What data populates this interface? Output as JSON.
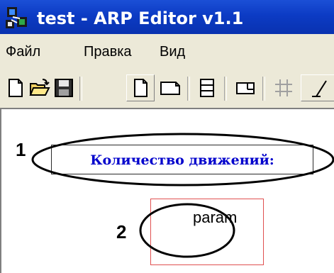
{
  "window": {
    "title": "test - ARP Editor v1.1",
    "app_icon": "arp-editor-app-icon"
  },
  "menubar": {
    "items": [
      {
        "label": "Файл"
      },
      {
        "label": "Правка"
      },
      {
        "label": "Вид"
      }
    ]
  },
  "toolbar": {
    "buttons": [
      {
        "icon": "new-document-icon"
      },
      {
        "icon": "open-folder-icon"
      },
      {
        "icon": "save-disk-icon"
      },
      {
        "icon": "portrait-page-icon",
        "pressed": true
      },
      {
        "icon": "landscape-page-icon"
      },
      {
        "icon": "horizontal-lines-icon"
      },
      {
        "icon": "label-frame-icon"
      },
      {
        "icon": "grid-icon"
      },
      {
        "icon": "text-tool-icon"
      }
    ]
  },
  "canvas": {
    "label_element": {
      "text": "Количество движений:",
      "color": "#0000cc"
    },
    "param_element": {
      "text": "param",
      "frame_color": "#e05050"
    },
    "callouts": [
      {
        "number": "1"
      },
      {
        "number": "2"
      }
    ]
  }
}
